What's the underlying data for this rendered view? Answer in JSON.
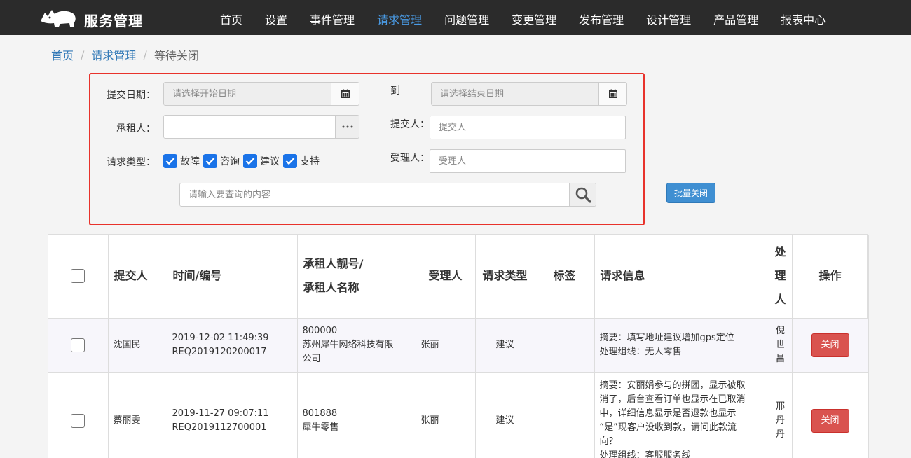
{
  "app": {
    "brand": "服务管理"
  },
  "nav": [
    "首页",
    "设置",
    "事件管理",
    "请求管理",
    "问题管理",
    "变更管理",
    "发布管理",
    "设计管理",
    "产品管理",
    "报表中心"
  ],
  "nav_active": "请求管理",
  "breadcrumb": {
    "home": "首页",
    "section": "请求管理",
    "current": "等待关闭",
    "separator": "/"
  },
  "filter": {
    "submit_date_label": "提交日期：",
    "start_date_placeholder": "请选择开始日期",
    "to_label": "到",
    "end_date_placeholder": "请选择结束日期",
    "tenant_label": "承租人：",
    "tenant_value": "",
    "submitter_label": "提交人：",
    "submitter_placeholder": "提交人",
    "type_label": "请求类型：",
    "types": [
      "故障",
      "咨询",
      "建议",
      "支持"
    ],
    "handler_label": "受理人：",
    "handler_placeholder": "受理人",
    "search_placeholder": "请输入要查询的内容"
  },
  "batch_close_label": "批量关闭",
  "table": {
    "headers": {
      "submitter": "提交人",
      "time_id": "时间/编号",
      "tenant_line1": "承租人靓号/",
      "tenant_line2": "承租人名称",
      "handler": "受理人",
      "req_type": "请求类型",
      "tag": "标签",
      "info": "请求信息",
      "processor": [
        "处",
        "理",
        "人"
      ],
      "action": "操作"
    },
    "rows": [
      {
        "submitter": "沈国民",
        "time": "2019-12-02 11:49:39",
        "id": "REQ2019120200017",
        "tenant_no": "800000",
        "tenant_name_1": "苏州犀牛网络科技有限",
        "tenant_name_2": "公司",
        "handler": "张丽",
        "type": "建议",
        "tag": "",
        "summary": "摘要：填写地址建议增加gps定位",
        "group": "处理组线：无人零售",
        "processor": [
          "倪",
          "世",
          "昌"
        ],
        "action": "关闭"
      },
      {
        "submitter": "蔡丽雯",
        "time": "2019-11-27 09:07:11",
        "id": "REQ2019112700001",
        "tenant_no": "801888",
        "tenant_name_1": "犀牛零售",
        "handler": "张丽",
        "type": "建议",
        "tag": "",
        "summary_lines": [
          "摘要：安丽娟参与的拼团，显示被取",
          "消了，后台查看订单也显示在已取消",
          "中，详细信息显示是否退款也显示",
          "“是”现客户没收到款，请问此款流",
          "向？"
        ],
        "group": "处理组线：客服服务线",
        "processor": [
          "邢",
          "丹",
          "丹"
        ],
        "action": "关闭"
      }
    ]
  }
}
